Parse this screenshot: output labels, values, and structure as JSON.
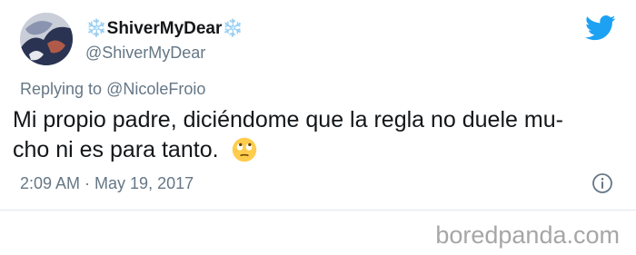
{
  "tweet": {
    "display_name": "❄️ShiverMyDear❄️",
    "handle": "@ShiverMyDear",
    "replying_prefix": "Replying to",
    "replying_to": "@NicoleFroio",
    "text_line_1": "Mi propio padre, diciéndome que la regla no duele mu-",
    "text_line_2": "cho ni es para tanto.",
    "emoji": "face-with-rolling-eyes",
    "timestamp": "2:09 AM · May 19, 2017"
  },
  "branding": {
    "platform_logo": "twitter-bird-icon",
    "watermark": "boredpanda.com"
  },
  "colors": {
    "twitter_blue": "#1da1f2",
    "secondary_text": "#657786",
    "primary_text": "#14171a",
    "emoji_yellow": "#ffcc4d"
  }
}
